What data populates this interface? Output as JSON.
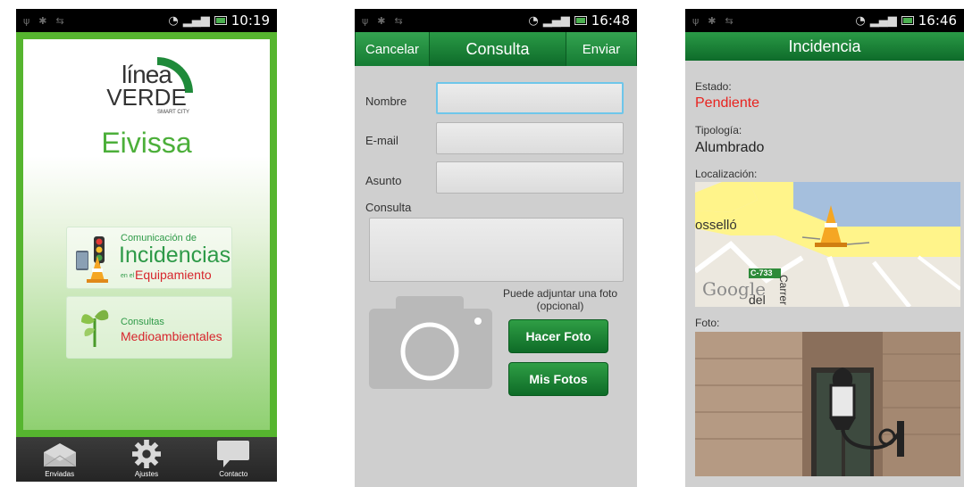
{
  "phone1": {
    "status_time": "10:19",
    "logo_linea": "línea",
    "logo_verde": "VERDE",
    "logo_smart": "SMART CITY",
    "city": "Eivissa",
    "incidencias_card": {
      "line1": "Comunicación de",
      "line2": "Incidencias",
      "line3_small": "en el",
      "line3": "Equipamiento"
    },
    "consultas_card": {
      "line1": "Consultas",
      "line2": "Medioambientales"
    },
    "tabs": [
      {
        "label": "Enviadas",
        "icon": "envelope-icon"
      },
      {
        "label": "Ajustes",
        "icon": "gear-icon"
      },
      {
        "label": "Contacto",
        "icon": "speech-bubble-icon"
      }
    ]
  },
  "phone2": {
    "status_time": "16:48",
    "cancel_label": "Cancelar",
    "title": "Consulta",
    "send_label": "Enviar",
    "fields": {
      "nombre": {
        "label": "Nombre",
        "value": ""
      },
      "email": {
        "label": "E-mail",
        "value": ""
      },
      "asunto": {
        "label": "Asunto",
        "value": ""
      }
    },
    "consulta_label": "Consulta",
    "consulta_value": "",
    "photo_hint": "Puede adjuntar una foto (opcional)",
    "take_photo_label": "Hacer Foto",
    "my_photos_label": "Mis Fotos"
  },
  "phone3": {
    "status_time": "16:46",
    "title": "Incidencia",
    "estado_label": "Estado:",
    "estado_value": "Pendiente",
    "tipologia_label": "Tipología:",
    "tipologia_value": "Alumbrado",
    "localizacion_label": "Localización:",
    "map": {
      "street1": "osselló",
      "road_badge": "C-733",
      "street2": "Carrer d",
      "attribution": "Google",
      "fragment": "del"
    },
    "foto_label": "Foto:"
  },
  "colors": {
    "brand_green": "#1f8a3a",
    "header_green": "#0e6b2a",
    "status_red": "#e8231f",
    "active_field": "#6ec6ea"
  }
}
